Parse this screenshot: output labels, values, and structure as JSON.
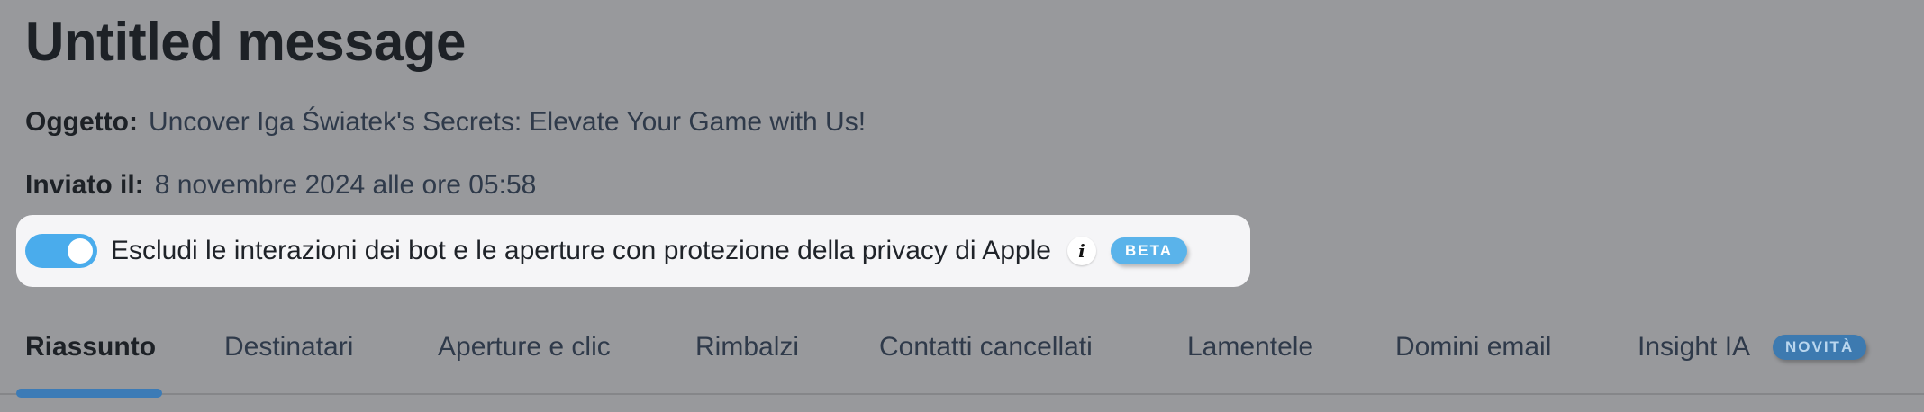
{
  "header": {
    "title": "Untitled message"
  },
  "meta": {
    "subject_label": "Oggetto:",
    "subject_value": "Uncover Iga Światek's Secrets: Elevate Your Game with Us!",
    "sent_label": "Inviato il:",
    "sent_value": "8 novembre 2024 alle ore 05:58"
  },
  "privacy": {
    "toggle_on": true,
    "label": "Escludi le interazioni dei bot e le aperture con protezione della privacy di Apple",
    "info_icon": "info-icon",
    "info_glyph": "i",
    "badge": "BETA"
  },
  "tabs": [
    {
      "label": "Riassunto",
      "active": true
    },
    {
      "label": "Destinatari",
      "active": false
    },
    {
      "label": "Aperture e clic",
      "active": false
    },
    {
      "label": "Rimbalzi",
      "active": false
    },
    {
      "label": "Contatti cancellati",
      "active": false
    },
    {
      "label": "Lamentele",
      "active": false
    },
    {
      "label": "Domini email",
      "active": false
    },
    {
      "label": "Insight IA",
      "active": false,
      "badge": "NOVITÀ"
    }
  ],
  "colors": {
    "background": "#98999c",
    "accent": "#4aacec",
    "tab_underline": "#3c7bb6",
    "privacy_box": "#f5f5f7"
  }
}
